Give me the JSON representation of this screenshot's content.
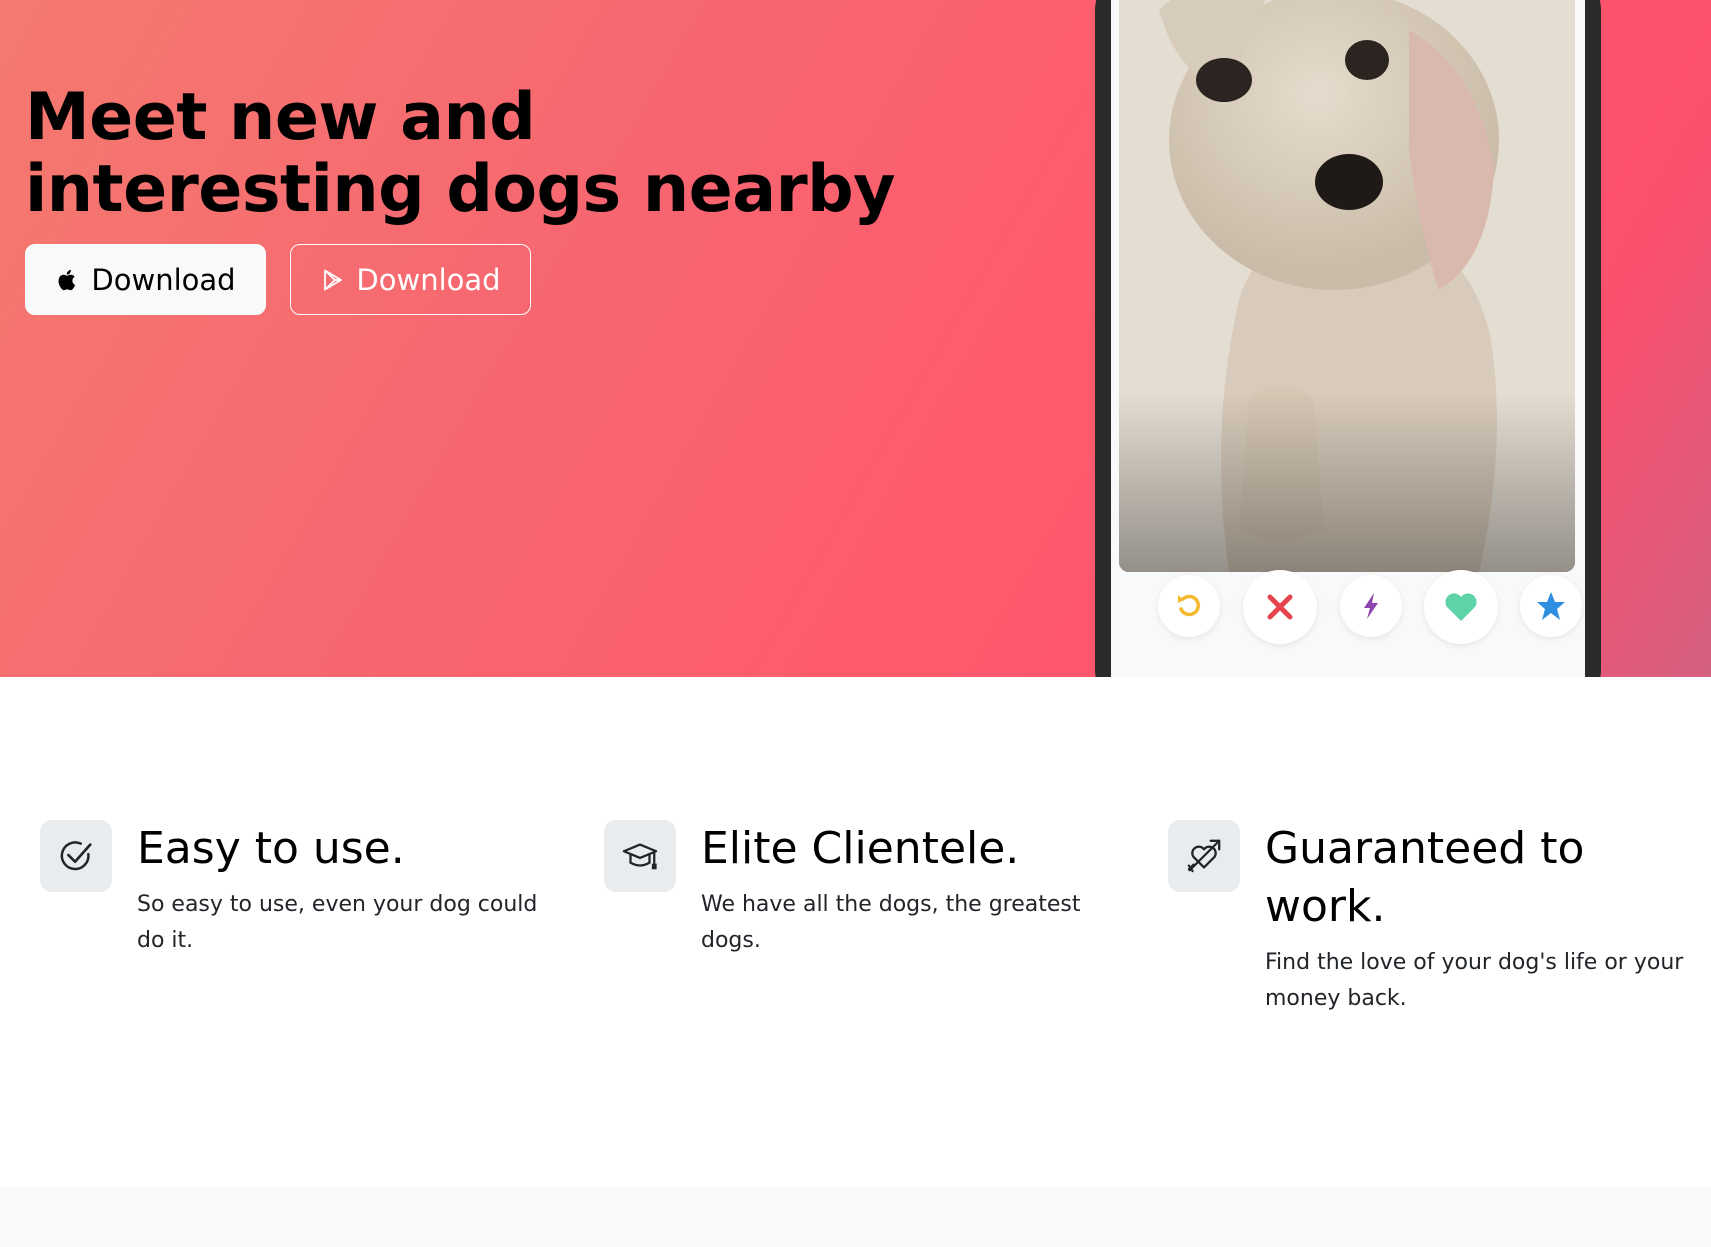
{
  "hero": {
    "title_line1": "Meet new and",
    "title_line2": "interesting dogs nearby",
    "apple_button_label": "Download",
    "google_button_label": "Download"
  },
  "phone": {
    "actions": [
      "rewind-icon",
      "nope-icon",
      "boost-icon",
      "like-icon",
      "super-like-icon"
    ]
  },
  "features": [
    {
      "icon": "check-circle-icon",
      "title": "Easy to use.",
      "text": "So easy to use, even your dog could do it."
    },
    {
      "icon": "graduation-cap-icon",
      "title": "Elite Clientele.",
      "text": "We have all the dogs, the greatest dogs."
    },
    {
      "icon": "heart-arrow-icon",
      "title": "Guaranteed to work.",
      "text": "Find the love of your dog's life or your money back."
    }
  ],
  "colors": {
    "hero_gradient_start": "#f47a6f",
    "hero_gradient_mid": "#ff5a6c",
    "hero_gradient_end": "#d4607f",
    "phone_frame": "#2a2a2a",
    "icon_bg": "#e9ecef"
  }
}
